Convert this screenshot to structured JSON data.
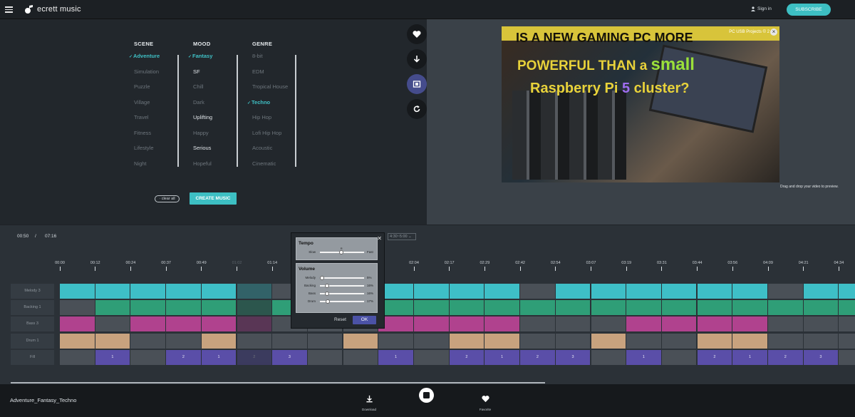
{
  "app": {
    "title": "ecrett music",
    "signin": "Sign in",
    "subscribe": "SUBSCRIBE"
  },
  "filters": {
    "scene": {
      "label": "SCENE",
      "items": [
        {
          "label": "Adventure",
          "state": "selected"
        },
        {
          "label": "Simulation",
          "state": "dim"
        },
        {
          "label": "Puzzle",
          "state": "dim"
        },
        {
          "label": "Village",
          "state": "dim"
        },
        {
          "label": "Travel",
          "state": "dim"
        },
        {
          "label": "Fitness",
          "state": "dim"
        },
        {
          "label": "Lifestyle",
          "state": "dim"
        },
        {
          "label": "Night",
          "state": "dim"
        }
      ]
    },
    "mood": {
      "label": "MOOD",
      "items": [
        {
          "label": "Fantasy",
          "state": "selected"
        },
        {
          "label": "SF",
          "state": "on"
        },
        {
          "label": "Chill",
          "state": "dim"
        },
        {
          "label": "Dark",
          "state": "dim"
        },
        {
          "label": "Uplifting",
          "state": "on"
        },
        {
          "label": "Happy",
          "state": "dim"
        },
        {
          "label": "Serious",
          "state": "on"
        },
        {
          "label": "Hopeful",
          "state": "dim"
        }
      ]
    },
    "genre": {
      "label": "GENRE",
      "items": [
        {
          "label": "8-bit",
          "state": "dim"
        },
        {
          "label": "EDM",
          "state": "dim"
        },
        {
          "label": "Tropical House",
          "state": "dim"
        },
        {
          "label": "Techno",
          "state": "selected"
        },
        {
          "label": "Hip Hop",
          "state": "dim"
        },
        {
          "label": "Lofi Hip Hop",
          "state": "dim"
        },
        {
          "label": "Acoustic",
          "state": "dim"
        },
        {
          "label": "Cinematic",
          "state": "dim"
        }
      ]
    },
    "clear_all": "clear all",
    "create_music": "CREATE MUSIC"
  },
  "preview": {
    "thumb_line1": "IS A NEW GAMING PC MORE",
    "thumb_line2a": "POWERFUL THAN a ",
    "thumb_line2b": "small",
    "thumb_line3a": "Raspberry Pi ",
    "thumb_line3b": "5",
    "thumb_line3c": " cluster?",
    "thumb_badge": "PC USB Projects © 2",
    "drag_note": "Drag and drop your video to preview."
  },
  "player": {
    "current_time": "00:50",
    "separator": "/",
    "total_time": "07:16",
    "range": "4:30~5:00"
  },
  "timeline": {
    "ticks": [
      "00:00",
      "00:12",
      "00:24",
      "00:37",
      "00:49",
      "01:02",
      "01:14",
      "01:27",
      "01:39",
      "01:51",
      "02:04",
      "02:17",
      "02:29",
      "02:42",
      "02:54",
      "03:07",
      "03:19",
      "03:31",
      "03:44",
      "03:56",
      "04:09",
      "04:21",
      "04:34"
    ],
    "ticks_dim": [
      5
    ],
    "rows": [
      {
        "name": "Melody 3",
        "color": "#3ebfc7",
        "pattern": [
          1,
          1,
          1,
          1,
          1,
          2,
          0,
          0,
          0,
          1,
          1,
          1,
          1,
          0,
          1,
          1,
          1,
          1,
          1,
          1,
          0,
          1,
          1
        ]
      },
      {
        "name": "Backing 1",
        "color": "#2f9e77",
        "pattern": [
          0,
          1,
          1,
          1,
          1,
          2,
          1,
          0,
          0,
          1,
          1,
          1,
          1,
          1,
          1,
          1,
          1,
          1,
          1,
          1,
          1,
          1,
          1
        ]
      },
      {
        "name": "Bass 3",
        "color": "#b0428e",
        "pattern": [
          1,
          0,
          1,
          1,
          1,
          2,
          0,
          0,
          0,
          1,
          1,
          1,
          1,
          0,
          0,
          0,
          1,
          1,
          1,
          1,
          0,
          0,
          0
        ]
      },
      {
        "name": "Drum 1",
        "color": "#c8a27e",
        "pattern": [
          1,
          1,
          0,
          0,
          1,
          0,
          0,
          0,
          1,
          0,
          0,
          1,
          1,
          0,
          0,
          1,
          0,
          0,
          1,
          1,
          0,
          0,
          0
        ]
      },
      {
        "name": "Fill",
        "color": "#5a4ea8",
        "pattern": [
          0,
          1,
          0,
          1,
          1,
          2,
          1,
          0,
          0,
          1,
          0,
          1,
          1,
          1,
          1,
          0,
          1,
          0,
          1,
          1,
          1,
          1,
          0
        ],
        "labels": [
          "",
          "1",
          "",
          "2",
          "1",
          "2",
          "3",
          "",
          "",
          "1",
          "",
          "2",
          "1",
          "2",
          "3",
          "",
          "1",
          "",
          "2",
          "1",
          "2",
          "3",
          ""
        ]
      }
    ]
  },
  "modal": {
    "tempo_title": "Tempo",
    "tempo": {
      "slow": "Slow",
      "fast": "Fast",
      "value": 0.48,
      "marker": "R"
    },
    "volume_title": "Volume",
    "volumes": [
      {
        "label": "Melody",
        "value": 0.05,
        "text": "5%"
      },
      {
        "label": "Backing",
        "value": 0.16,
        "text": "16%"
      },
      {
        "label": "Bass",
        "value": 0.16,
        "text": "16%"
      },
      {
        "label": "Drum",
        "value": 0.17,
        "text": "17%"
      }
    ],
    "reset": "Reset",
    "ok": "OK"
  },
  "bottom": {
    "song_name": "Adventure_Fantasy_Techno",
    "download": "Download",
    "favorite": "Favorite"
  }
}
